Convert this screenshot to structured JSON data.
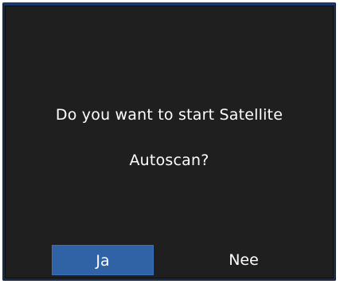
{
  "dialog": {
    "message_line1": "Do you want to start Satellite",
    "message_line2": "Autoscan?"
  },
  "buttons": {
    "yes_label": "Ja",
    "no_label": "Nee",
    "selected": "Ja"
  },
  "colors": {
    "background": "#1f1f1f",
    "frame_border": "#1b3a6b",
    "selected_button": "#2f63a6",
    "text": "#ffffff"
  }
}
